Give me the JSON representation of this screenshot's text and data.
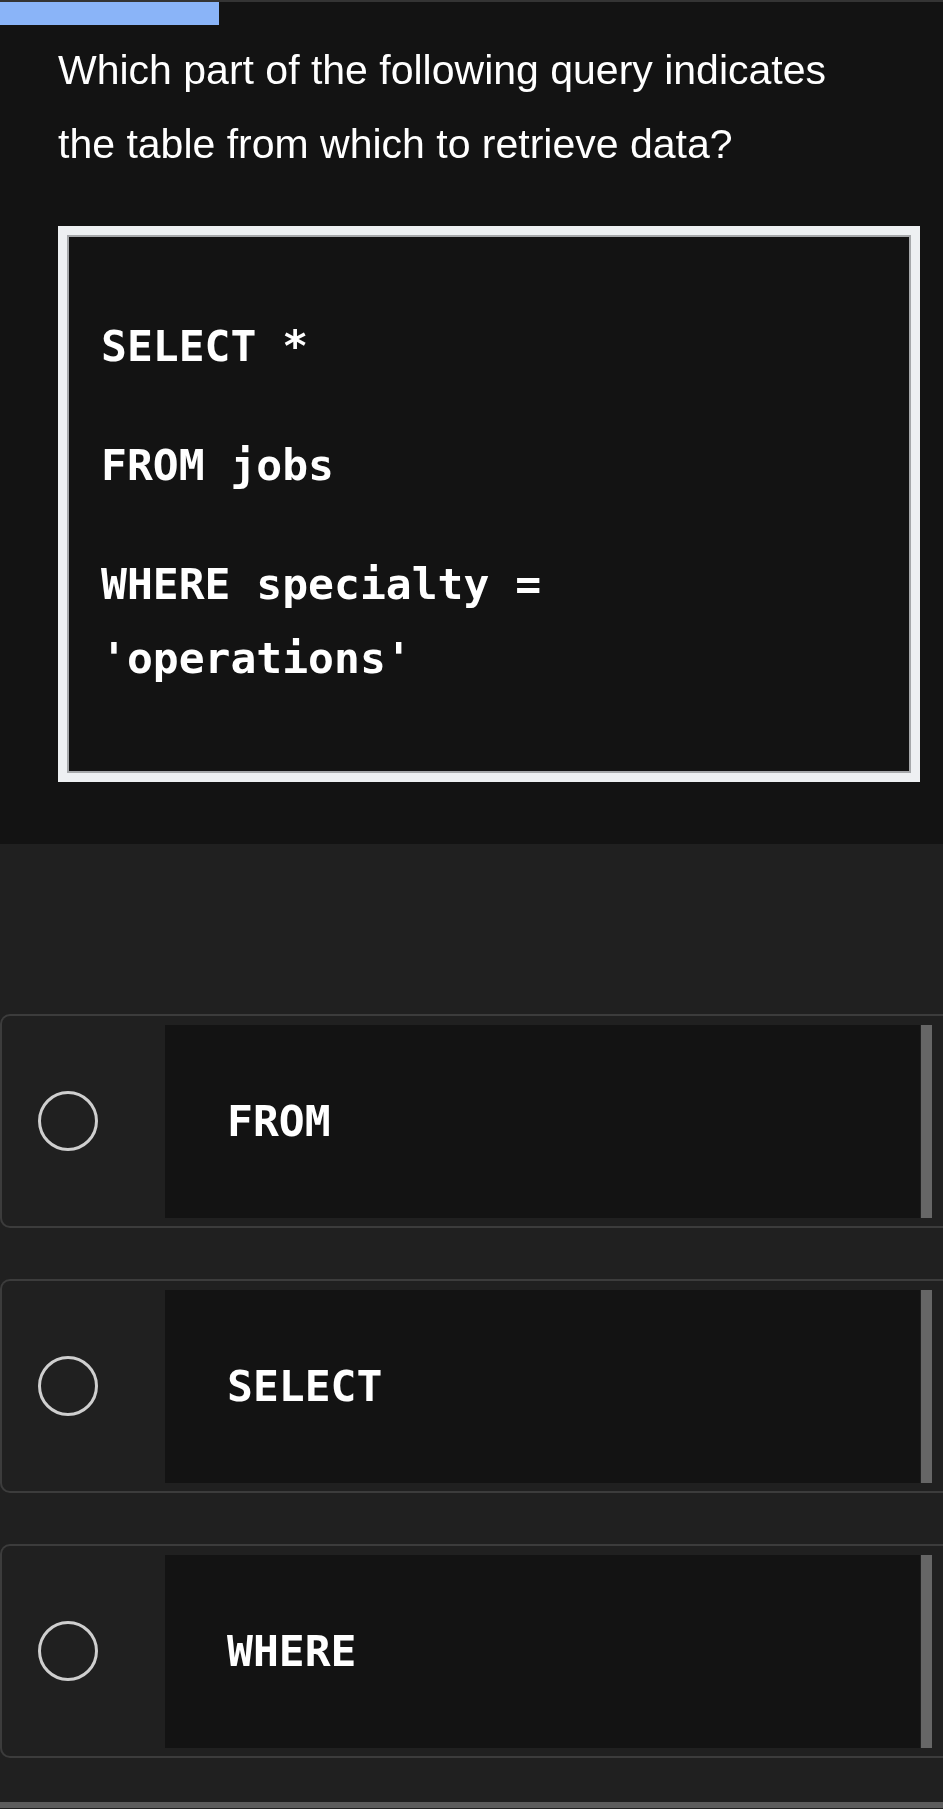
{
  "progress": {
    "level": 0.232
  },
  "question": {
    "text": "Which part of the following query indicates the table from which to retrieve data?"
  },
  "code_block": {
    "lines": [
      "SELECT *",
      "FROM jobs",
      "WHERE specialty = 'operations'"
    ]
  },
  "options": [
    {
      "label": "FROM",
      "selected": false
    },
    {
      "label": "SELECT",
      "selected": false
    },
    {
      "label": "WHERE",
      "selected": false
    }
  ]
}
